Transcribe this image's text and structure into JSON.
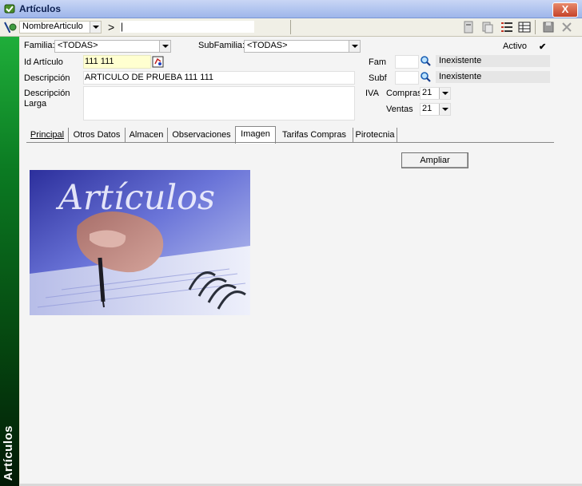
{
  "window": {
    "title": "Artículos",
    "close_label": "X"
  },
  "toolbar": {
    "sort_field": "NombreArticulo",
    "nav_symbol": ">",
    "search_value": "|"
  },
  "sidebar": {
    "label": "Artículos"
  },
  "filters": {
    "familia_label": "Familia:",
    "familia_value": "<TODAS>",
    "subfamilia_label": "SubFamilia:",
    "subfamilia_value": "<TODAS>",
    "activo_label": "Activo",
    "activo_checked": "✔"
  },
  "form": {
    "id_label": "Id Artículo",
    "id_value": "111 111",
    "desc_label": "Descripción",
    "desc_value": "ARTICULO DE PRUEBA 111 111",
    "desc_larga_label_1": "Descripción",
    "desc_larga_label_2": "Larga",
    "desc_larga_value": "",
    "fam_label": "Fam",
    "fam_value": "",
    "fam_name": "Inexistente",
    "subf_label": "Subf",
    "subf_value": "",
    "subf_name": "Inexistente",
    "iva_label": "IVA",
    "compras_label": "Compras",
    "compras_value": "21",
    "ventas_label": "Ventas",
    "ventas_value": "21"
  },
  "tabs": [
    "Principal",
    "Otros Datos",
    "Almacen",
    "Observaciones",
    "Imagen",
    "Tarifas Compras",
    "Pirotecnia"
  ],
  "active_tab": "Imagen",
  "imagen": {
    "ampliar_label": "Ampliar",
    "photo_text": "Artículos"
  },
  "colors": {
    "sidebar_green": "#0b7a22",
    "id_field_bg": "#ffffd0"
  }
}
